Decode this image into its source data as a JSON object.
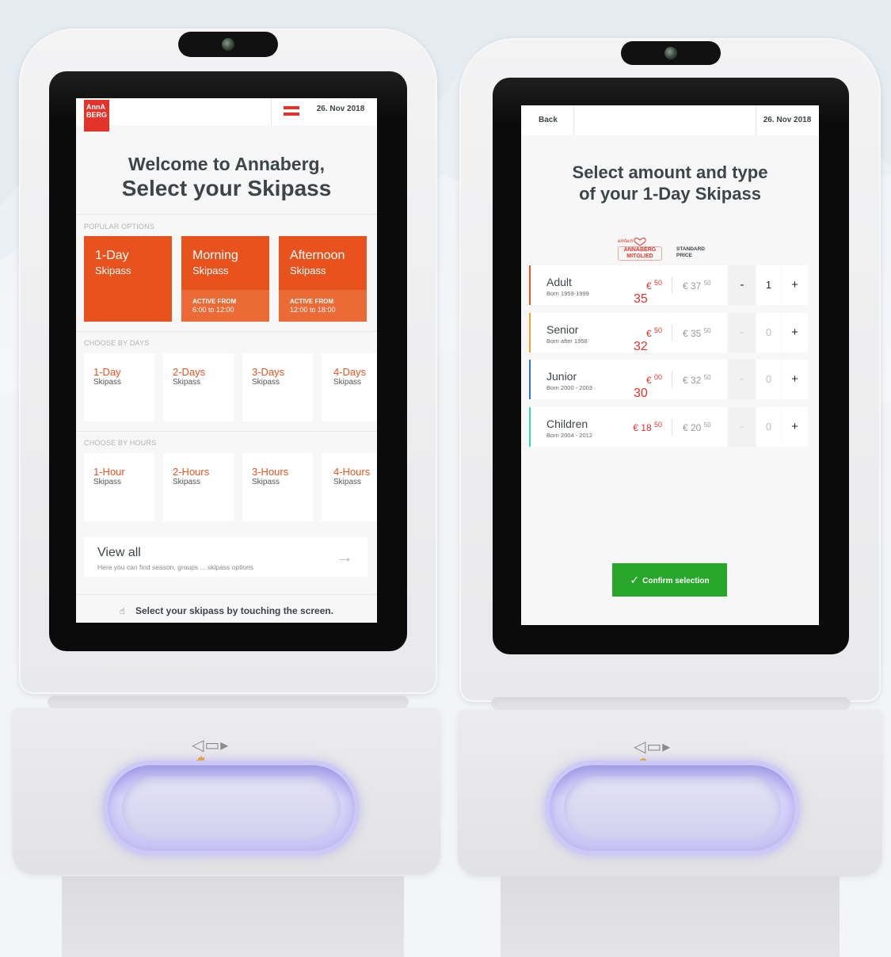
{
  "left_screen": {
    "logo_text": "AnnA BERG",
    "date": "26. Nov 2018",
    "title_line1": "Welcome to Annaberg,",
    "title_line2": "Select your Skipass",
    "popular_label": "POPULAR OPTIONS",
    "popular": [
      {
        "title": "1-Day",
        "subtitle": "Skipass",
        "active_from": "",
        "time": ""
      },
      {
        "title": "Morning",
        "subtitle": "Skipass",
        "active_from": "ACTIVE FROM",
        "time": "6:00 to 12:00"
      },
      {
        "title": "Afternoon",
        "subtitle": "Skipass",
        "active_from": "ACTIVE FROM",
        "time": "12:00 to 18:00"
      }
    ],
    "days_label": "CHOOSE BY DAYS",
    "days": [
      {
        "title": "1-Day",
        "subtitle": "Skipass"
      },
      {
        "title": "2-Days",
        "subtitle": "Skipass"
      },
      {
        "title": "3-Days",
        "subtitle": "Skipass"
      },
      {
        "title": "4-Days",
        "subtitle": "Skipass"
      }
    ],
    "hours_label": "CHOOSE BY HOURS",
    "hours": [
      {
        "title": "1-Hour",
        "subtitle": "Skipass"
      },
      {
        "title": "2-Hours",
        "subtitle": "Skipass"
      },
      {
        "title": "3-Hours",
        "subtitle": "Skipass"
      },
      {
        "title": "4-Hours",
        "subtitle": "Skipass"
      }
    ],
    "view_all_title": "View all",
    "view_all_subtitle": "Here you can find season, groups ... skipass options",
    "hint": "Select your skipass by touching the screen."
  },
  "right_screen": {
    "back": "Back",
    "date": "26. Nov 2018",
    "title_line1": "Select amount and type",
    "title_line2": "of your 1-Day Skipass",
    "member_col_small": "einfach",
    "member_col_line1": "ANNABERG",
    "member_col_line2": "MITGLIED",
    "std_col_line1": "STANDARD",
    "std_col_line2": "PRICE",
    "rows": [
      {
        "name": "Adult",
        "born": "Born 1959-1999",
        "member_price": "€",
        "member_cents": "50",
        "std_price": "€ 37",
        "std_cents": "50",
        "minus": "-",
        "qty": "1",
        "plus": "+",
        "overlay": "35",
        "color": "#e8531d",
        "active": true
      },
      {
        "name": "Senior",
        "born": "Born after 1958",
        "member_price": "€",
        "member_cents": "50",
        "std_price": "€ 35",
        "std_cents": "50",
        "minus": "-",
        "qty": "0",
        "plus": "+",
        "overlay": "32",
        "color": "#f0a22e",
        "active": false
      },
      {
        "name": "Junior",
        "born": "Born 2000 - 2003",
        "member_price": "€",
        "member_cents": "00",
        "std_price": "€ 32",
        "std_cents": "50",
        "minus": "-",
        "qty": "0",
        "plus": "+",
        "overlay": "30",
        "color": "#2e6fd0",
        "active": false
      },
      {
        "name": "Children",
        "born": "Born  2004 - 2012",
        "member_price": "€ 18",
        "member_cents": "50",
        "std_price": "€ 20",
        "std_cents": "50",
        "minus": "-",
        "qty": "0",
        "plus": "+",
        "overlay": "",
        "color": "#33d3b7",
        "active": false
      }
    ],
    "confirm": "Confirm selection"
  },
  "colors": {
    "brand_orange": "#e8531d",
    "brand_red": "#e2342a",
    "confirm_green": "#27a62a",
    "text_dark": "#3d4548"
  }
}
